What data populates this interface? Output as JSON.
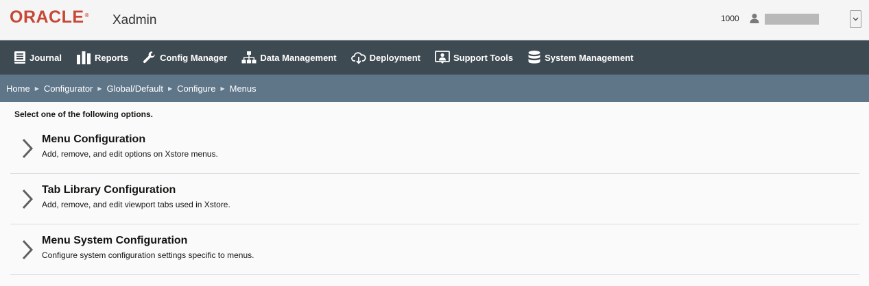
{
  "header": {
    "logo_text": "ORACLE",
    "logo_reg": "®",
    "app_name": "Xadmin",
    "store_number": "1000"
  },
  "nav": {
    "items": [
      {
        "label": "Journal",
        "icon": "journal-icon"
      },
      {
        "label": "Reports",
        "icon": "bar-chart-icon"
      },
      {
        "label": "Config Manager",
        "icon": "wrench-icon"
      },
      {
        "label": "Data Management",
        "icon": "hierarchy-icon"
      },
      {
        "label": "Deployment",
        "icon": "cloud-download-icon"
      },
      {
        "label": "Support Tools",
        "icon": "support-icon"
      },
      {
        "label": "System Management",
        "icon": "database-icon"
      }
    ]
  },
  "breadcrumb": [
    "Home",
    "Configurator",
    "Global/Default",
    "Configure",
    "Menus"
  ],
  "main": {
    "instructions": "Select one of the following options.",
    "options": [
      {
        "title": "Menu Configuration",
        "description": "Add, remove, and edit options on Xstore menus."
      },
      {
        "title": "Tab Library Configuration",
        "description": "Add, remove, and edit viewport tabs used in Xstore."
      },
      {
        "title": "Menu System Configuration",
        "description": "Configure system configuration settings specific to menus."
      }
    ]
  },
  "colors": {
    "brand_red": "#c74634",
    "nav_bg": "#3e4a51",
    "breadcrumb_bg": "#5f7689"
  }
}
